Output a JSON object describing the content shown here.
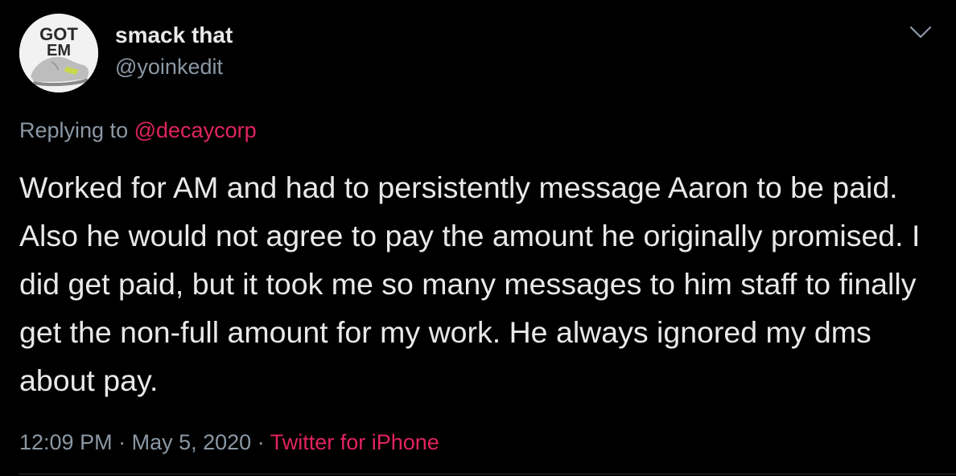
{
  "tweet": {
    "author": {
      "display_name": "smack that",
      "handle": "@yoinkedit",
      "avatar_text_line1": "GOT",
      "avatar_text_line2": "EM"
    },
    "menu_icon": "chevron-down-icon",
    "reply": {
      "prefix": "Replying to",
      "mention": "@decaycorp"
    },
    "text": "Worked for AM and had to persistently message Aaron to be paid. Also he would not agree to pay the amount he originally promised. I did get paid, but it took me so many messages to him staff to finally get the non-full amount for my work. He always ignored my dms about pay.",
    "time": "12:09 PM",
    "separator": "·",
    "date": "May 5, 2020",
    "source": "Twitter for iPhone"
  },
  "colors": {
    "background": "#000000",
    "primary_text": "#e7e9ea",
    "secondary_text": "#8b98a5",
    "accent": "#e0245e"
  }
}
